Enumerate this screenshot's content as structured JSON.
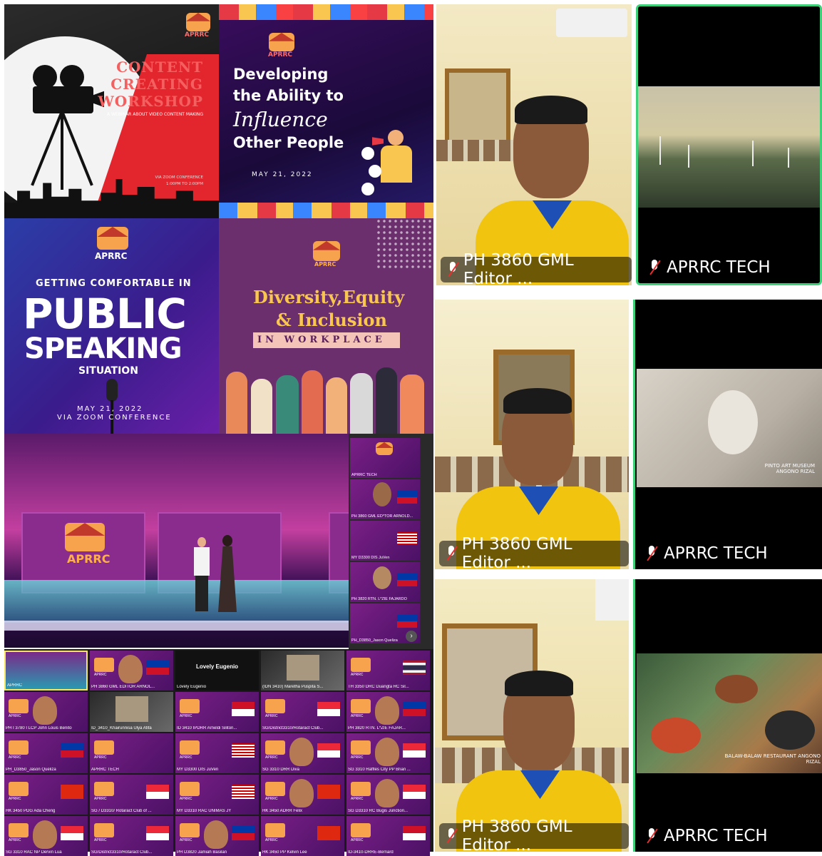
{
  "posters": {
    "content_workshop": {
      "logo": "APRRC",
      "title_1": "CONTENT",
      "title_2": "CREATING",
      "title_3": "WORKSHOP",
      "subtitle": "A WEBINAR ABOUT VIDEO CONTENT MAKING",
      "venue": "VIA ZOOM CONFERENCE",
      "time": "1:00PM TO 2:00PM"
    },
    "influence": {
      "logo": "APRRC",
      "line_1": "Developing",
      "line_2": "the Ability to",
      "line_3": "Influence",
      "line_4": "Other People",
      "date": "MAY 21, 2022"
    },
    "public_speaking": {
      "logo": "APRRC",
      "top": "GETTING COMFORTABLE IN",
      "big_1": "PUBLIC",
      "big_2": "SPEAKING",
      "bottom": "SITUATION",
      "date": "MAY 21, 2022",
      "venue": "VIA ZOOM CONFERENCE"
    },
    "diversity": {
      "logo": "APRRC",
      "line_1": "Diversity,Equity",
      "line_2": "& Inclusion",
      "banner": "IN WORKPLACE"
    }
  },
  "stage": {
    "screen_logo": "APRRC"
  },
  "side_strip": [
    {
      "name": "APRRC TECH"
    },
    {
      "name": "PH 3860 GML ED*TOR ARNOLD..."
    },
    {
      "name": "MY D3300 DIS JuVen"
    },
    {
      "name": "PH 3820 RTN. L*ZIE FAJARDO"
    },
    {
      "name": "PH_D3850_Jason Queliza"
    }
  ],
  "gallery": [
    {
      "name": "APRRC",
      "type": "stage"
    },
    {
      "name": "PH 3860 GML EDITOR ARNOL...",
      "type": "face",
      "flag": "ph"
    },
    {
      "name": "Lovely Eugenio",
      "type": "text",
      "center": "Lovely Eugenio"
    },
    {
      "name": "(IDN 3410) Maretha Puspita S...",
      "type": "photo"
    },
    {
      "name": "TH 3350 DRC Duangta RC Sil...",
      "type": "logo",
      "flag": "th"
    },
    {
      "name": "PH I 3780 I LCP John Louis Benito",
      "type": "face"
    },
    {
      "name": "ID_3410_Khairunnisa Ulya Afifa",
      "type": "photo"
    },
    {
      "name": "ID 3410 IPDRR Arneldi Siliton...",
      "type": "logo",
      "flag": "id"
    },
    {
      "name": "SG/District3310/Rotaract Club...",
      "type": "logo",
      "flag": "sg"
    },
    {
      "name": "PH 3820 RTN. L*ZIE FAJAR...",
      "type": "face",
      "flag": "ph"
    },
    {
      "name": "PH_D3850_Jason Queliza",
      "type": "logo",
      "flag": "ph"
    },
    {
      "name": "APRRC TECH",
      "type": "logo"
    },
    {
      "name": "MY D3300 DIS JuVen",
      "type": "logo",
      "flag": "my"
    },
    {
      "name": "SG 3310 DRR Diva",
      "type": "face",
      "flag": "sg"
    },
    {
      "name": "SG 3310 Raffles City PP Brian ...",
      "type": "face",
      "flag": "sg"
    },
    {
      "name": "HK 3450 PDG Ada Cheng",
      "type": "logo",
      "flag": "hk"
    },
    {
      "name": "SG / D3310/ Rotaract Club of ...",
      "type": "logo",
      "flag": "sg"
    },
    {
      "name": "MY D3310 RAC UNIMAS JY",
      "type": "logo",
      "flag": "my"
    },
    {
      "name": "HK 3450 ADRR Felix",
      "type": "face",
      "flag": "hk"
    },
    {
      "name": "SG D3310 RC Bugis Junction...",
      "type": "face",
      "flag": "sg"
    },
    {
      "name": "SG 3310 RAC NP Dervin Lua",
      "type": "face",
      "flag": "sg"
    },
    {
      "name": "SG/District3310/Rotaract Club...",
      "type": "logo",
      "flag": "sg"
    },
    {
      "name": "PH D3820 Jamiah Basilan",
      "type": "face",
      "flag": "ph"
    },
    {
      "name": "HK 3450 PP Kelvin Lee",
      "type": "logo",
      "flag": "hk"
    },
    {
      "name": "ID-3410-DRRE-Bernard",
      "type": "logo",
      "flag": "id"
    }
  ],
  "video_tiles": [
    {
      "row": 1,
      "left_name": "PH 3860 GML Editor ...",
      "right_name": "APRRC TECH",
      "right_overlay": ""
    },
    {
      "row": 2,
      "left_name": "PH 3860 GML Editor ...",
      "right_name": "APRRC TECH",
      "right_overlay": "PINTO ART MUSEUM ANGONO RIZAL"
    },
    {
      "row": 3,
      "left_name": "PH 3860 GML Editor ...",
      "right_name": "APRRC TECH",
      "right_overlay": "BALAW-BALAW RESTAURANT ANGONO RIZAL"
    }
  ],
  "colors": {
    "active_speaker_border": "#3fd07a",
    "muted_mic": "#e5302f",
    "tile_bg": "#000000",
    "shirt_yellow": "#f1c40f",
    "shirt_blue": "#1d4fb5"
  }
}
